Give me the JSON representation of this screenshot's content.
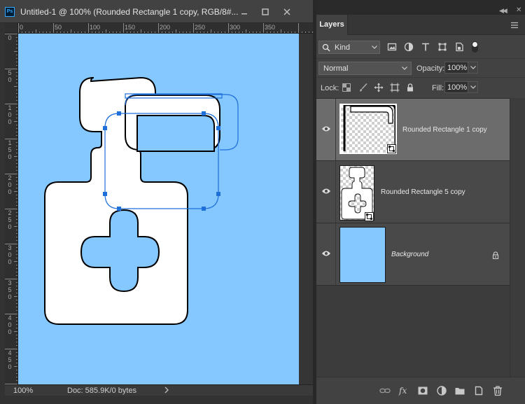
{
  "document": {
    "title": "Untitled-1 @ 100% (Rounded Rectangle 1 copy, RGB/8#...",
    "app_icon": "Ps",
    "zoom": "100%",
    "doc_size": "Doc: 585.9K/0 bytes",
    "canvas_color": "#85c7ff",
    "ruler_top_labels": [
      "0",
      "50",
      "100",
      "150",
      "200",
      "250",
      "300",
      "350"
    ],
    "ruler_left_labels": [
      [
        "0"
      ],
      [
        "5",
        "0"
      ],
      [
        "1",
        "0",
        "0"
      ],
      [
        "1",
        "5",
        "0"
      ],
      [
        "2",
        "0",
        "0"
      ],
      [
        "2",
        "5",
        "0"
      ],
      [
        "3",
        "0",
        "0"
      ],
      [
        "3",
        "5",
        "0"
      ],
      [
        "4",
        "0",
        "0"
      ],
      [
        "4",
        "5",
        "0"
      ]
    ]
  },
  "layers_panel": {
    "tab_label": "Layers",
    "filter_kind": "Kind",
    "blend_mode": "Normal",
    "opacity_label": "Opacity:",
    "opacity_value": "100%",
    "lock_label": "Lock:",
    "fill_label": "Fill:",
    "fill_value": "100%",
    "layers": [
      {
        "name": "Rounded Rectangle 1 copy",
        "selected": true,
        "visible": true
      },
      {
        "name": "Rounded Rectangle 5 copy",
        "selected": false,
        "visible": true
      },
      {
        "name": "Background",
        "selected": false,
        "visible": true,
        "locked": true
      }
    ]
  },
  "icons": {
    "window_controls": [
      "minimize-icon",
      "maximize-icon",
      "close-icon"
    ],
    "filter_icons": [
      "image-filter-icon",
      "adjustment-filter-icon",
      "type-filter-icon",
      "shape-filter-icon",
      "smart-object-filter-icon"
    ],
    "lock_icons": [
      "lock-transparent-pixels-icon",
      "lock-image-pixels-icon",
      "lock-position-icon",
      "lock-artboard-icon",
      "lock-all-icon"
    ],
    "footer_icons": [
      "link-layers-icon",
      "fx-icon",
      "add-mask-icon",
      "new-adjustment-layer-icon",
      "new-group-icon",
      "new-layer-icon",
      "delete-layer-icon"
    ]
  }
}
